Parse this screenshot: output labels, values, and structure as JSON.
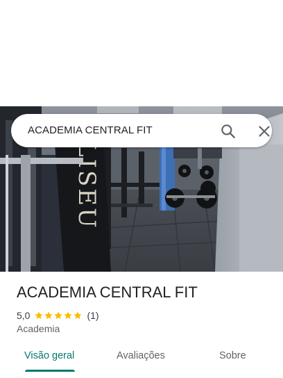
{
  "search": {
    "query": "ACADEMIA CENTRAL FIT",
    "search_icon": "search-icon",
    "close_icon": "close-icon"
  },
  "place": {
    "name": "ACADEMIA CENTRAL FIT",
    "rating": "5,0",
    "stars": 5,
    "review_count": "(1)",
    "category": "Academia"
  },
  "tabs": [
    {
      "label": "Visão geral",
      "active": true
    },
    {
      "label": "Avaliações",
      "active": false
    },
    {
      "label": "Sobre",
      "active": false
    }
  ],
  "photo": {
    "sign_text": "LISEU"
  },
  "colors": {
    "accent": "#00796b",
    "star": "#fbbc04",
    "text_primary": "#202124",
    "text_secondary": "#5f6368"
  }
}
